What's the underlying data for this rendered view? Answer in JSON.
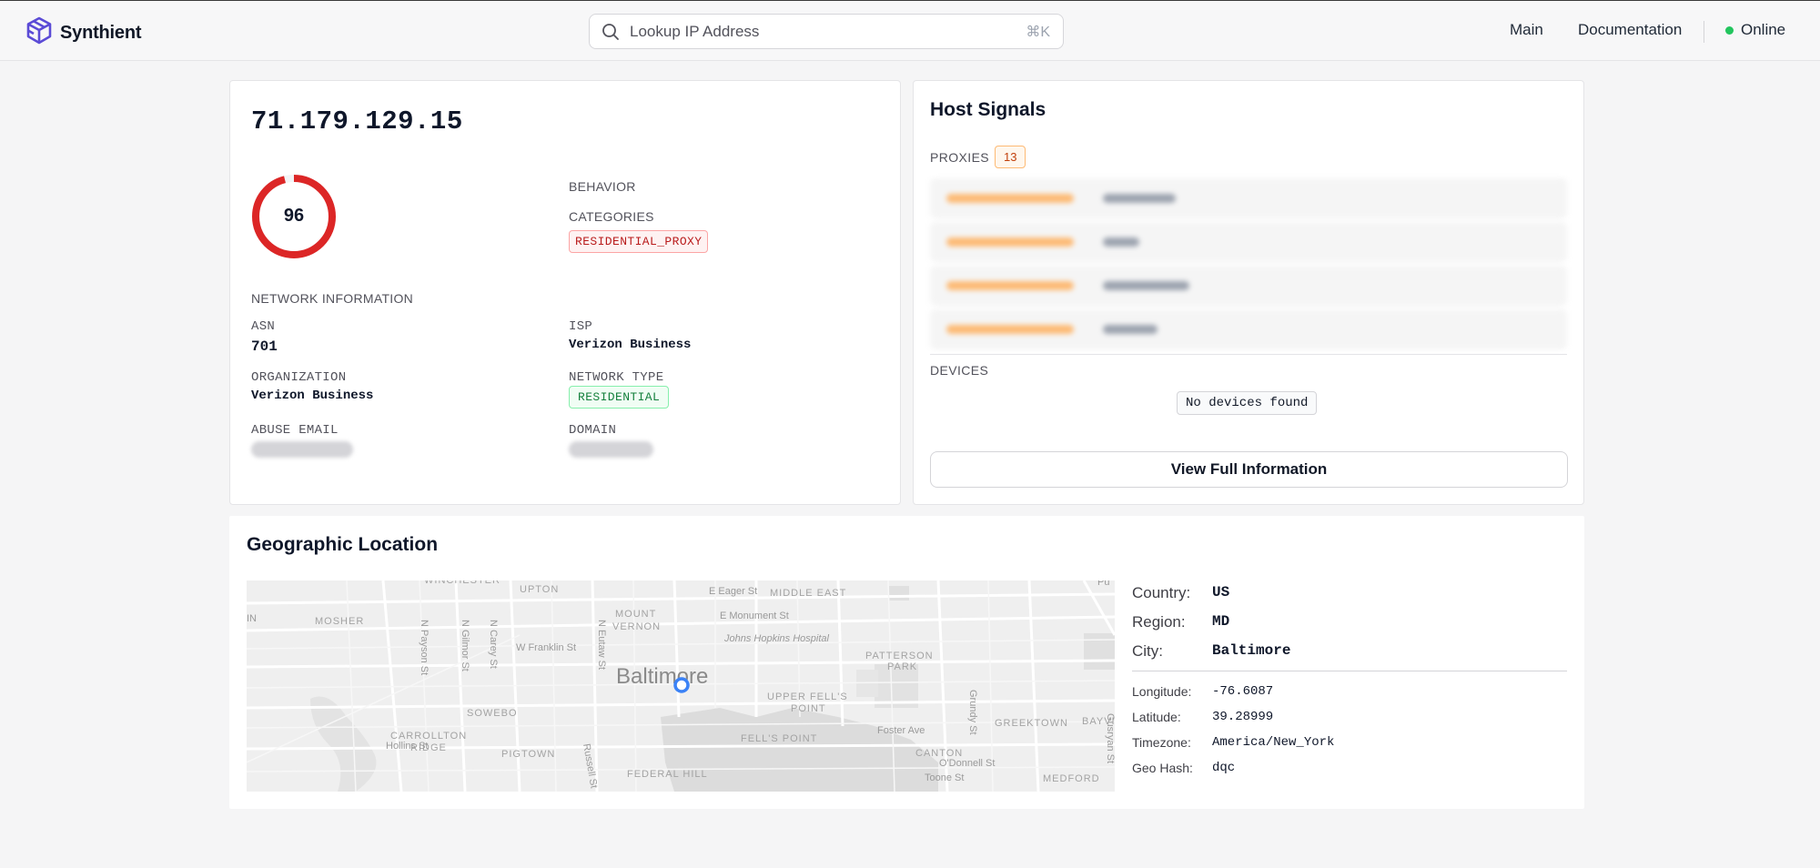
{
  "header": {
    "brand": "Synthient",
    "search_placeholder": "Lookup IP Address",
    "search_shortcut": "⌘K",
    "nav": [
      "Main",
      "Documentation"
    ],
    "status": "Online"
  },
  "ip_card": {
    "ip": "71.179.129.15",
    "score": "96",
    "score_fraction": 0.96,
    "behavior_label": "BEHAVIOR",
    "categories_label": "CATEGORIES",
    "category_tag": "RESIDENTIAL_PROXY",
    "network_info_label": "NETWORK INFORMATION",
    "asn_label": "ASN",
    "asn": "701",
    "isp_label": "ISP",
    "isp": "Verizon Business",
    "org_label": "ORGANIZATION",
    "org": "Verizon Business",
    "network_type_label": "NETWORK TYPE",
    "network_type": "RESIDENTIAL",
    "abuse_email_label": "ABUSE EMAIL",
    "domain_label": "DOMAIN",
    "colors": {
      "danger": "#dc2626",
      "ok": "#15803d"
    }
  },
  "host_signals": {
    "title": "Host Signals",
    "proxies_label": "PROXIES",
    "proxies_count": "13",
    "devices_label": "DEVICES",
    "no_devices": "No devices found",
    "view_button": "View Full Information"
  },
  "geo": {
    "title": "Geographic Location",
    "country_label": "Country:",
    "country": "US",
    "region_label": "Region:",
    "region": "MD",
    "city_label": "City:",
    "city": "Baltimore",
    "longitude_label": "Longitude:",
    "longitude": "-76.6087",
    "latitude_label": "Latitude:",
    "latitude": "39.28999",
    "timezone_label": "Timezone:",
    "timezone": "America/New_York",
    "geohash_label": "Geo Hash:",
    "geohash": "dqc",
    "map": {
      "city_label": "Baltimore",
      "labels": [
        "WINCHESTER",
        "UPTON",
        "E Eager St",
        "MIDDLE EAST",
        "MOSHER",
        "MOUNT VERNON",
        "E Monument St",
        "Johns Hopkins Hospital",
        "W Franklin St",
        "N Payson St",
        "N Gilmor St",
        "N Carey St",
        "N Eutaw St",
        "PATTERSON PARK",
        "UPPER FELLS POINT",
        "Hollins St",
        "SOWEBO",
        "CARROLLTON RIDGE",
        "PIGTOWN",
        "FELL'S POINT",
        "Foster Ave",
        "CANTON",
        "GREEKTOWN",
        "O'Donnell St",
        "Toone St",
        "FEDERAL HILL",
        "MEDFORD",
        "Grundy St",
        "BAYVIE",
        "Gusryan St",
        "Russell St"
      ]
    }
  }
}
